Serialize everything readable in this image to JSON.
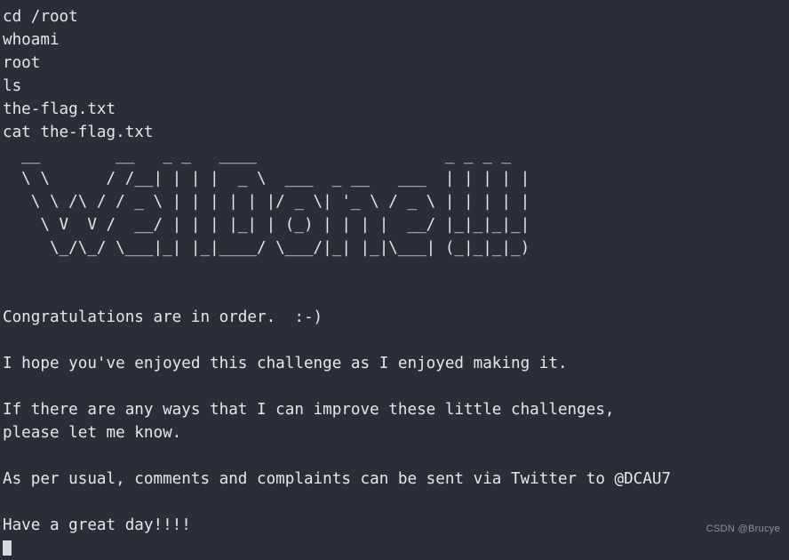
{
  "terminal": {
    "background_color": "#2b2e39",
    "text_color": "#e6e6ec",
    "commands": [
      "cd /root",
      "whoami",
      "root",
      "ls",
      "the-flag.txt",
      "cat the-flag.txt"
    ],
    "ascii_art": "  __        __   _ _   ____                    _ _ _ _\n  \\ \\      / /__| | | |  _ \\  ___  _ __   ___  | | | | |\n   \\ \\ /\\ / / _ \\ | | | | | |/ _ \\| '_ \\ / _ \\ | | | | |\n    \\ V  V /  __/ | | | |_| | (_) | | | |  __/ |_|_|_|_|\n     \\_/\\_/ \\___|_| |_|____/ \\___/|_| |_|\\___| (_|_|_|_)",
    "messages": [
      "Congratulations are in order.  :-)",
      "I hope you've enjoyed this challenge as I enjoyed making it.",
      "If there are any ways that I can improve these little challenges,",
      "please let me know.",
      "As per usual, comments and complaints can be sent via Twitter to @DCAU7",
      "Have a great day!!!!"
    ]
  },
  "watermark": {
    "text": "CSDN @Brucye",
    "color": "#8d9099"
  }
}
